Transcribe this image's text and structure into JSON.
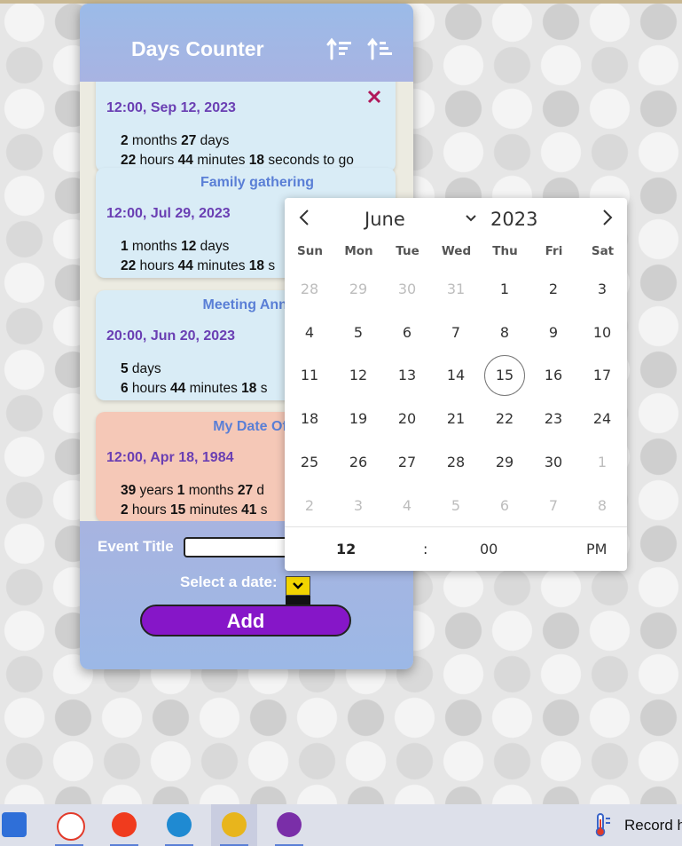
{
  "app": {
    "title": "Days Counter",
    "sort_asc_icon": "sort-ascending-icon",
    "sort_desc_icon": "sort-descending-icon"
  },
  "events": [
    {
      "title": "",
      "date": "12:00, Sep 12, 2023",
      "remaining_line1": [
        {
          "n": "2",
          "u": " months "
        },
        {
          "n": "27",
          "u": " days"
        }
      ],
      "remaining_line2": [
        {
          "n": "22",
          "u": " hours "
        },
        {
          "n": "44",
          "u": " minutes "
        },
        {
          "n": "18",
          "u": " seconds to go"
        }
      ],
      "show_delete": true
    },
    {
      "title": "Family gathering",
      "date": "12:00, Jul 29, 2023",
      "remaining_line1": [
        {
          "n": "1",
          "u": " months "
        },
        {
          "n": "12",
          "u": " days"
        }
      ],
      "remaining_line2": [
        {
          "n": "22",
          "u": " hours "
        },
        {
          "n": "44",
          "u": " minutes "
        },
        {
          "n": "18",
          "u": " s"
        }
      ]
    },
    {
      "title": "Meeting Anna af",
      "date": "20:00, Jun 20, 2023",
      "remaining_line1": [
        {
          "n": "5",
          "u": " days"
        }
      ],
      "remaining_line2": [
        {
          "n": "6",
          "u": " hours "
        },
        {
          "n": "44",
          "u": " minutes "
        },
        {
          "n": "18",
          "u": " s"
        }
      ]
    },
    {
      "title": "My Date Of B",
      "date": "12:00, Apr 18, 1984",
      "remaining_line1": [
        {
          "n": "39",
          "u": " years "
        },
        {
          "n": "1",
          "u": " months "
        },
        {
          "n": "27",
          "u": " d"
        }
      ],
      "remaining_line2": [
        {
          "n": "2",
          "u": " hours "
        },
        {
          "n": "15",
          "u": " minutes "
        },
        {
          "n": "41",
          "u": " s"
        }
      ],
      "style": "birthday"
    }
  ],
  "form": {
    "event_title_label": "Event Title",
    "event_title_value": "",
    "select_date_label": "Select a date:",
    "add_label": "Add",
    "date_toggle_icon": "chevron-down-icon"
  },
  "picker": {
    "month": "June",
    "year": "2023",
    "prev_icon": "chevron-left-icon",
    "next_icon": "chevron-right-icon",
    "weekdays": [
      "Sun",
      "Mon",
      "Tue",
      "Wed",
      "Thu",
      "Fri",
      "Sat"
    ],
    "weeks": [
      [
        [
          "28",
          1
        ],
        [
          "29",
          1
        ],
        [
          "30",
          1
        ],
        [
          "31",
          1
        ],
        [
          "1",
          0
        ],
        [
          "2",
          0
        ],
        [
          "3",
          0
        ]
      ],
      [
        [
          "4",
          0
        ],
        [
          "5",
          0
        ],
        [
          "6",
          0
        ],
        [
          "7",
          0
        ],
        [
          "8",
          0
        ],
        [
          "9",
          0
        ],
        [
          "10",
          0
        ]
      ],
      [
        [
          "11",
          0
        ],
        [
          "12",
          0
        ],
        [
          "13",
          0
        ],
        [
          "14",
          0
        ],
        [
          "15",
          2
        ],
        [
          "16",
          0
        ],
        [
          "17",
          0
        ]
      ],
      [
        [
          "18",
          0
        ],
        [
          "19",
          0
        ],
        [
          "20",
          0
        ],
        [
          "21",
          0
        ],
        [
          "22",
          0
        ],
        [
          "23",
          0
        ],
        [
          "24",
          0
        ]
      ],
      [
        [
          "25",
          0
        ],
        [
          "26",
          0
        ],
        [
          "27",
          0
        ],
        [
          "28",
          0
        ],
        [
          "29",
          0
        ],
        [
          "30",
          0
        ],
        [
          "1",
          1
        ]
      ],
      [
        [
          "2",
          1
        ],
        [
          "3",
          1
        ],
        [
          "4",
          1
        ],
        [
          "5",
          1
        ],
        [
          "6",
          1
        ],
        [
          "7",
          1
        ],
        [
          "8",
          1
        ]
      ]
    ],
    "time": {
      "hour": "12",
      "separator": ":",
      "minute": "00",
      "ampm": "PM"
    }
  },
  "taskbar": {
    "items": [
      {
        "name": "store-icon",
        "color": "#2f6fd8",
        "active": false
      },
      {
        "name": "yandex-browser-icon",
        "color": "#ffffff",
        "active": false
      },
      {
        "name": "yandex-icon",
        "color": "#f03b1e",
        "active": false
      },
      {
        "name": "vscode-icon",
        "color": "#1f8ad2",
        "active": false
      },
      {
        "name": "chrome-icon",
        "color": "#e8b51c",
        "active": true
      },
      {
        "name": "github-icon",
        "color": "#7a2ea8",
        "active": false
      }
    ],
    "tray_icon": "thermometer-icon",
    "tray_label": "Record h"
  },
  "colors": {
    "accent_purple": "#8616c8",
    "date_purple": "#6a3fb3",
    "title_blue": "#5a7fd6",
    "delete_red": "#b0185a",
    "card_blue": "#d9ecf6",
    "card_birthday": "#f5c8b7"
  }
}
